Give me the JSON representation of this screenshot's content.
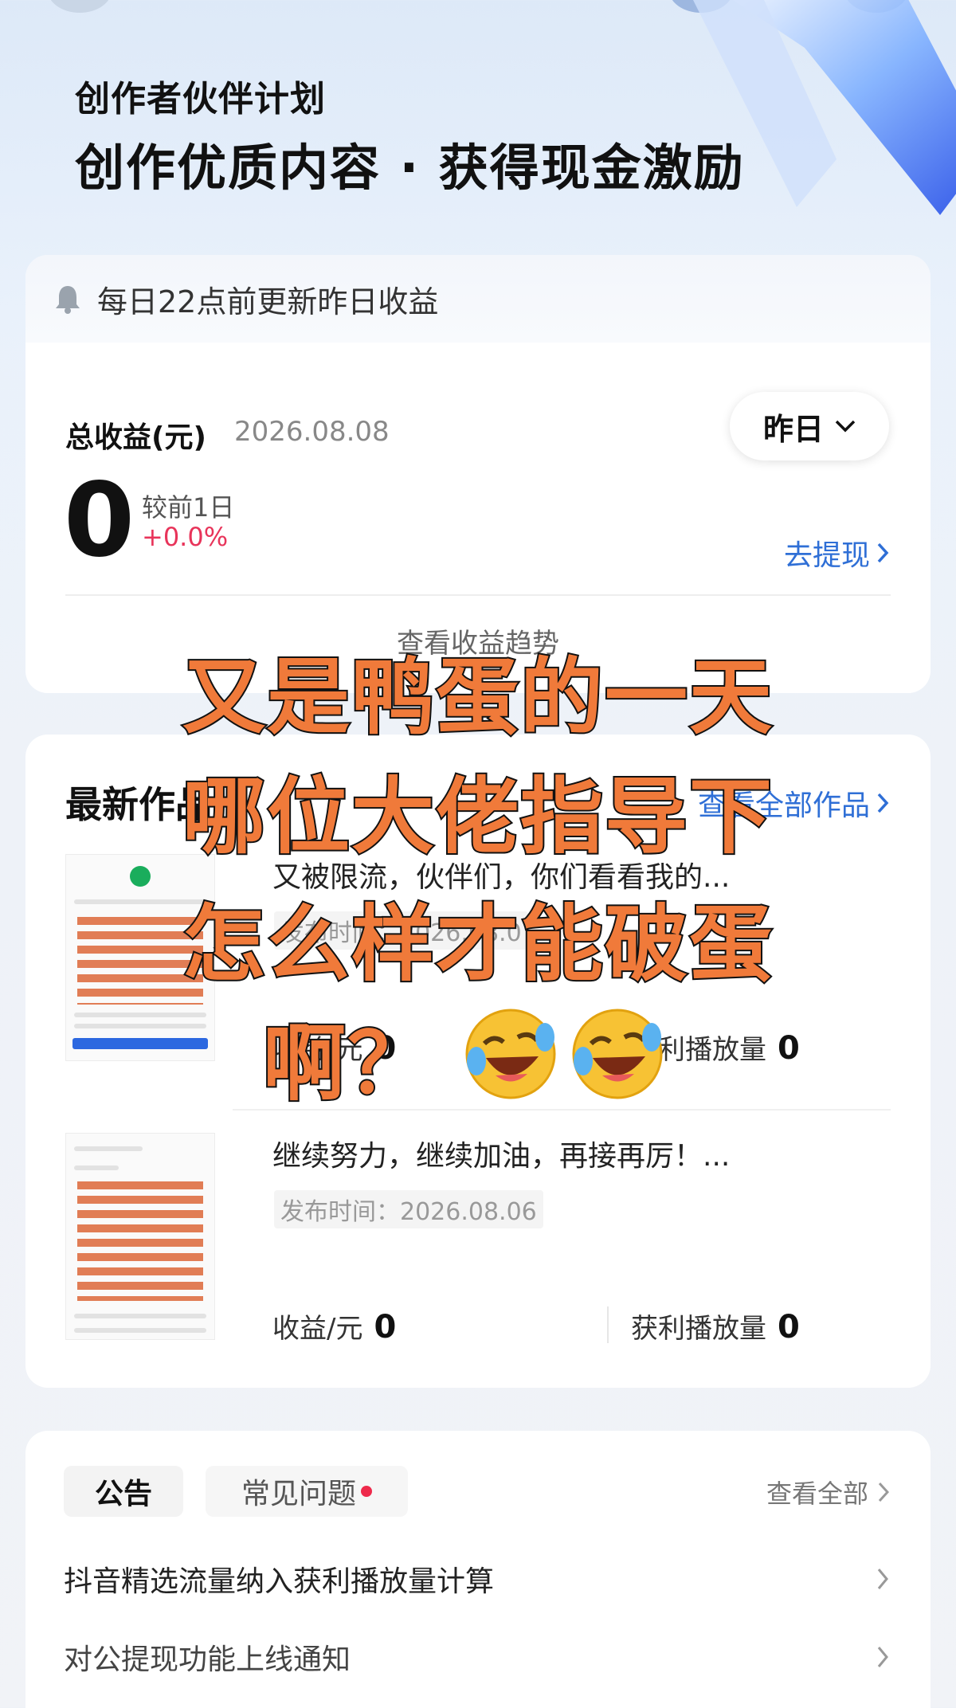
{
  "header": {
    "subtitle": "创作者伙伴计划",
    "title": "创作优质内容 · 获得现金激励"
  },
  "earnings": {
    "notice": "每日22点前更新昨日收益",
    "total_label": "总收益(元)",
    "date": "2026.08.08",
    "period_label": "昨日",
    "total_value": "0",
    "compare_label": "较前1日",
    "compare_value": "+0.0%",
    "withdraw_label": "去提现",
    "trend_link": "查看收益趋势"
  },
  "works": {
    "title": "最新作品",
    "view_all": "查看全部作品",
    "items": [
      {
        "title": "又被限流，伙伴们，你们看看我的...",
        "date": "发布时间：2026.08.0",
        "earn_label": "收益/元",
        "earn_value": "0",
        "play_label": "获利播放量",
        "play_value": "0"
      },
      {
        "title": "继续努力，继续加油，再接再厉！...",
        "date": "发布时间：2026.08.06",
        "earn_label": "收益/元",
        "earn_value": "0",
        "play_label": "获利播放量",
        "play_value": "0"
      }
    ]
  },
  "announcements": {
    "tabs": [
      "公告",
      "常见问题"
    ],
    "view_all": "查看全部",
    "items": [
      "抖音精选流量纳入获利播放量计算",
      "对公提现功能上线通知"
    ]
  },
  "caption": {
    "lines": [
      "又是鸭蛋的一天",
      "哪位大佬指导下",
      "怎么样才能破蛋",
      "啊？"
    ],
    "emoji": [
      "rolling-on-floor-laughing-icon",
      "rolling-on-floor-laughing-icon"
    ]
  },
  "colors": {
    "accent_blue": "#2f6fd6",
    "positive_red": "#e8345a",
    "caption_orange": "#f07a3a"
  }
}
